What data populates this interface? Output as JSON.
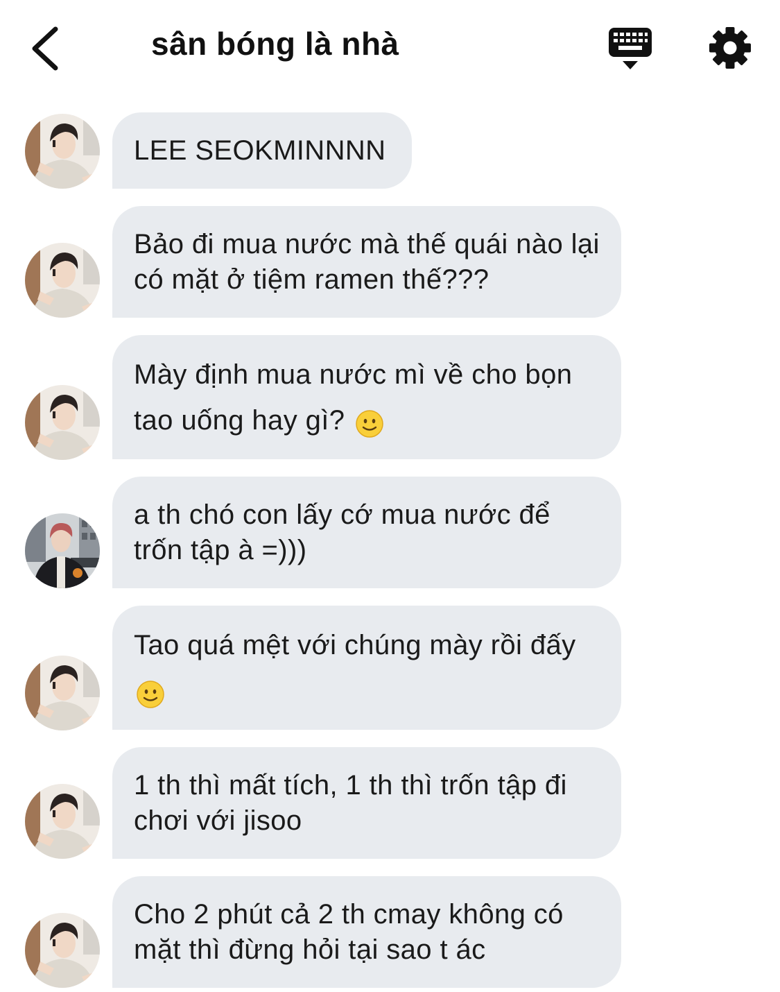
{
  "header": {
    "title": "sân bóng là nhà",
    "back_icon": "chevron-left-icon",
    "keyboard_icon": "keyboard-icon",
    "settings_icon": "gear-icon"
  },
  "colors": {
    "bubble_bg": "#e8ebef",
    "text": "#1a1a1a"
  },
  "messages": [
    {
      "text": "LEE SEOKMINNNN",
      "avatar": "avatar-seokmin"
    },
    {
      "text": "Bảo đi mua nước mà thế quái nào lại có mặt ở tiệm ramen thế???",
      "avatar": "avatar-seokmin"
    },
    {
      "text": "Mày định mua nước mì về cho bọn tao uống hay gì?",
      "emoji": "🙂",
      "avatar": "avatar-seokmin"
    },
    {
      "text": "a th chó con lấy cớ mua nước để trốn tập à =)))",
      "avatar": "avatar-other"
    },
    {
      "text": "Tao quá mệt với chúng mày rồi đấy",
      "emoji": "🙂",
      "avatar": "avatar-seokmin"
    },
    {
      "text": "1 th thì mất tích, 1 th thì trốn tập đi chơi với jisoo",
      "avatar": "avatar-seokmin"
    },
    {
      "text": "Cho 2 phút cả 2 th cmay không có mặt thì đừng hỏi tại sao t ác",
      "avatar": "avatar-seokmin"
    }
  ]
}
